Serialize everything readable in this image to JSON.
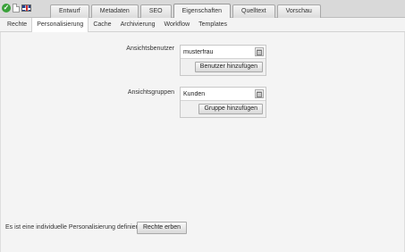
{
  "status_icons": [
    "check-icon",
    "document-icon",
    "uk-flag-icon"
  ],
  "tabs": [
    {
      "label": "Entwurf",
      "active": false
    },
    {
      "label": "Metadaten",
      "active": false
    },
    {
      "label": "SEO",
      "active": false
    },
    {
      "label": "Eigenschaften",
      "active": true
    },
    {
      "label": "Quelltext",
      "active": false
    },
    {
      "label": "Vorschau",
      "active": false
    }
  ],
  "subtabs": [
    {
      "label": "Rechte",
      "active": false
    },
    {
      "label": "Personalisierung",
      "active": true
    },
    {
      "label": "Cache",
      "active": false
    },
    {
      "label": "Archivierung",
      "active": false
    },
    {
      "label": "Workflow",
      "active": false
    },
    {
      "label": "Templates",
      "active": false
    }
  ],
  "view_user": {
    "label": "Ansichtsbenutzer",
    "value": "musterfrau",
    "add_button": "Benutzer hinzufügen"
  },
  "view_group": {
    "label": "Ansichtsgruppen",
    "value": "Kunden",
    "add_button": "Gruppe hinzufügen"
  },
  "footer": {
    "message": "Es ist eine individuelle Personalisierung definiert.",
    "inherit_button": "Rechte erben"
  },
  "colors": {
    "topbar": "#d9d9d9",
    "content_bg": "#f4f4f4",
    "check_green": "#3aa13a"
  }
}
